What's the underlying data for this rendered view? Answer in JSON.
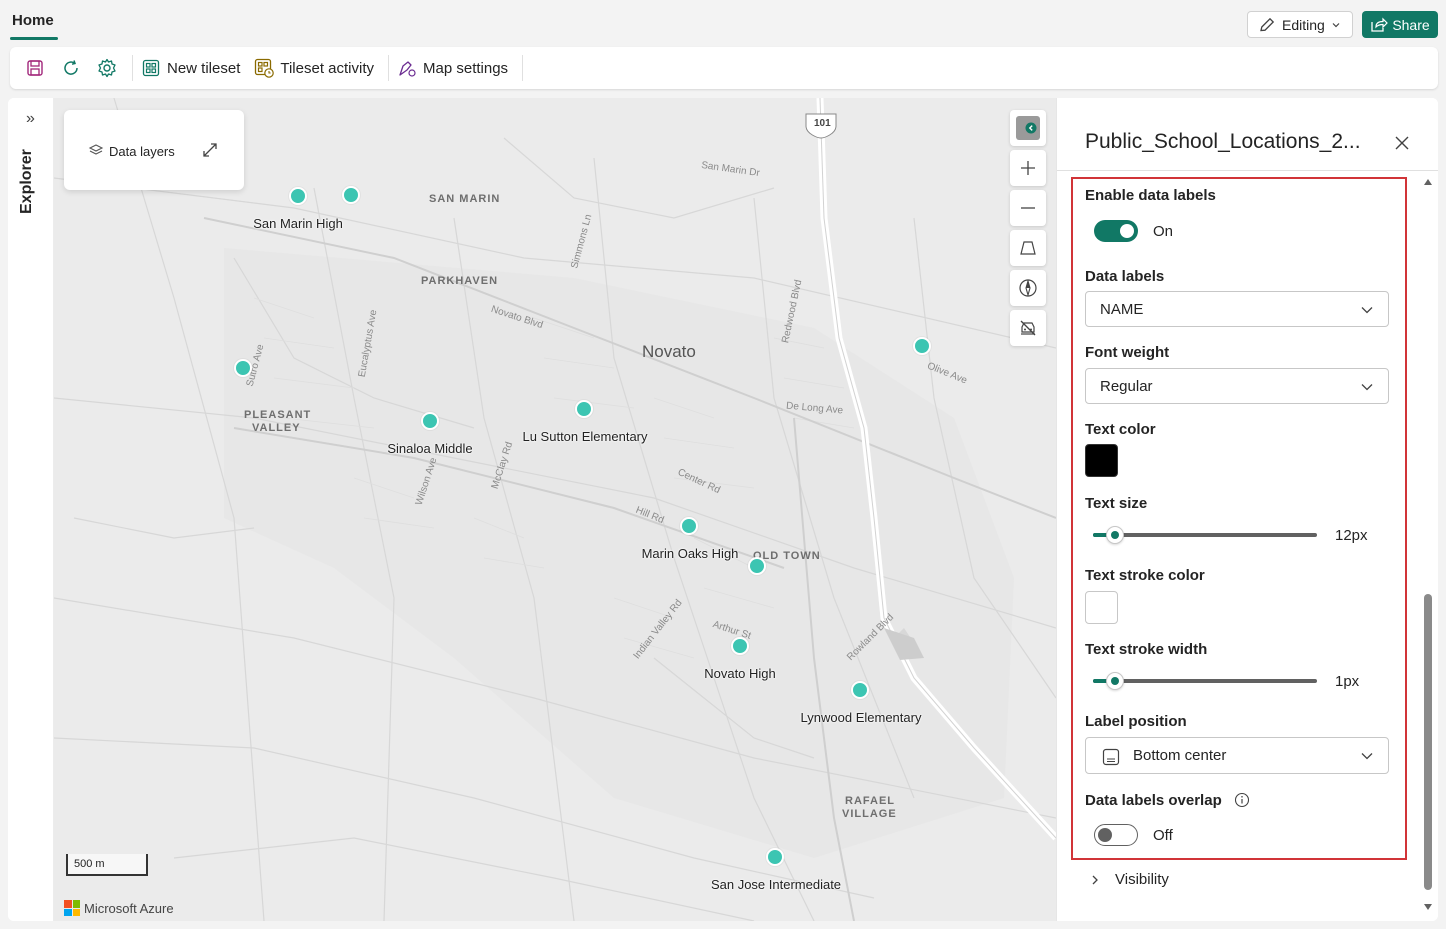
{
  "topbar": {
    "home_tab": "Home",
    "editing_label": "Editing",
    "share_label": "Share"
  },
  "toolbar": {
    "new_tileset": "New tileset",
    "tileset_activity": "Tileset activity",
    "map_settings": "Map settings"
  },
  "explorer": {
    "label": "Explorer"
  },
  "map": {
    "data_layers_label": "Data layers",
    "city": "Novato",
    "highway_shield": "101",
    "scale_label": "500 m",
    "attribution": "Microsoft Azure",
    "places": {
      "san_marin": "SAN MARIN",
      "parkhaven": "PARKHAVEN",
      "pleasant_valley_1": "PLEASANT",
      "pleasant_valley_2": "VALLEY",
      "old_town": "OLD TOWN",
      "rafael_village_1": "RAFAEL",
      "rafael_village_2": "VILLAGE"
    },
    "streets": {
      "san_marin_dr": "San Marin Dr",
      "simmons_ln": "Simmons Ln",
      "novato_blvd": "Novato Blvd",
      "eucalyptus_ave": "Eucalyptus Ave",
      "sutro_ave": "Sutro Ave",
      "redwood_blvd": "Redwood Blvd",
      "olive_ave": "Olive Ave",
      "de_long_ave": "De Long Ave",
      "center_rd": "Center Rd",
      "hill_rd": "Hill Rd",
      "mcclay_rd": "McClay Rd",
      "wilson_ave": "Wilson Ave",
      "indian_valley_rd": "Indian Valley Rd",
      "arthur_st": "Arthur St",
      "rowland_blvd": "Rowland Blvd"
    },
    "schools": [
      {
        "name": "San Marin High"
      },
      {
        "name": "Sinaloa Middle"
      },
      {
        "name": "Lu Sutton Elementary"
      },
      {
        "name": "Marin Oaks High"
      },
      {
        "name": "Novato High"
      },
      {
        "name": "Lynwood Elementary"
      },
      {
        "name": "San Jose Intermediate"
      }
    ],
    "dot_color": "#3cc5b2"
  },
  "panel": {
    "title": "Public_School_Locations_2...",
    "enable_data_labels": {
      "label": "Enable data labels",
      "state": "On"
    },
    "data_labels": {
      "label": "Data labels",
      "value": "NAME"
    },
    "font_weight": {
      "label": "Font weight",
      "value": "Regular"
    },
    "text_color": {
      "label": "Text color",
      "color": "#000000"
    },
    "text_size": {
      "label": "Text size",
      "value": "12px",
      "fraction": 0.1
    },
    "text_stroke_color": {
      "label": "Text stroke color",
      "color": "#ffffff"
    },
    "text_stroke_width": {
      "label": "Text stroke width",
      "value": "1px",
      "fraction": 0.1
    },
    "label_position": {
      "label": "Label position",
      "value": "Bottom center"
    },
    "data_labels_overlap": {
      "label": "Data labels overlap",
      "state": "Off"
    },
    "visibility": "Visibility"
  },
  "colors": {
    "accent": "#117865",
    "highlight_box": "#d13438"
  }
}
